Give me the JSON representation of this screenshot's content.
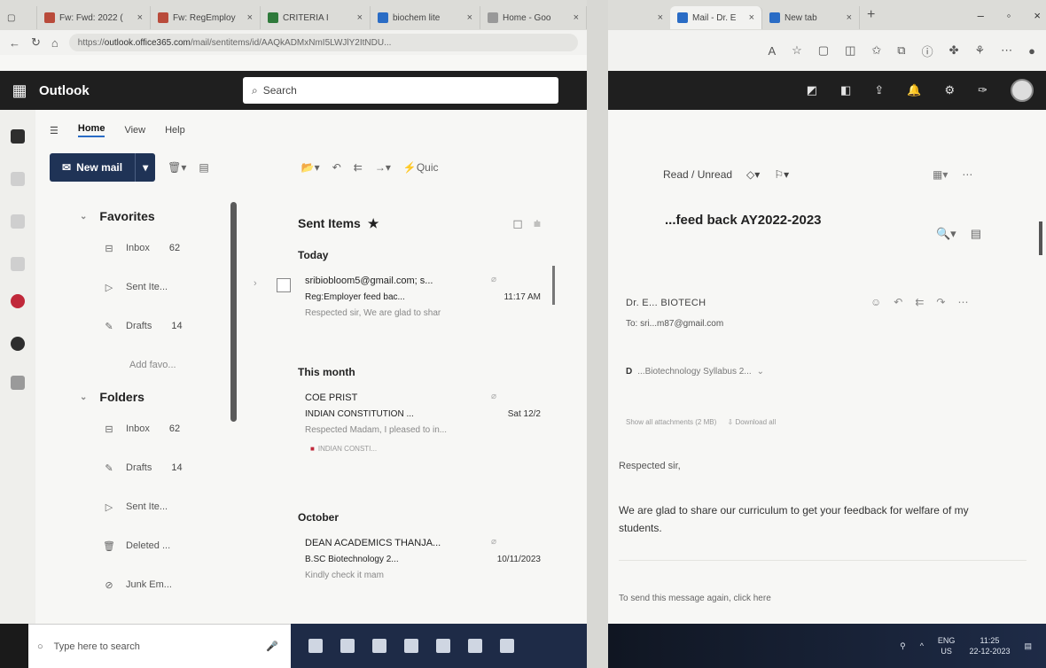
{
  "browser": {
    "tabs_left": [
      {
        "label": "Fw: Fwd: 2022 (",
        "icon_color": "#b94b3b"
      },
      {
        "label": "Fw: RegEmploy",
        "icon_color": "#b94b3b"
      },
      {
        "label": "CRITERIA I",
        "icon_color": "#2f7a3b"
      },
      {
        "label": "biochem lite",
        "icon_color": "#2a6cc5"
      },
      {
        "label": "Home - Goo",
        "icon_color": "#999999"
      }
    ],
    "tabs_right": [
      {
        "label": "Mail - Dr. E",
        "icon_color": "#2a6cc5"
      },
      {
        "label": "New tab",
        "icon_color": "#2a6cc5"
      }
    ],
    "url_prefix": "https://",
    "url_host": "outlook.office365.com",
    "url_path": "/mail/sentitems/id/AAQkADMxNmI5LWJlY2ItNDU..."
  },
  "outlook": {
    "brand": "Outlook",
    "search_placeholder": "Search",
    "ribbon_tabs": [
      "Home",
      "View",
      "Help"
    ],
    "new_mail": "New mail",
    "quick_steps": "Quic",
    "folders": {
      "favorites_label": "Favorites",
      "favorites": [
        {
          "label": "Inbox",
          "count": "62",
          "icon": "inbox-icon"
        },
        {
          "label": "Sent Ite...",
          "count": "",
          "icon": "send-icon"
        },
        {
          "label": "Drafts",
          "count": "14",
          "icon": "drafts-icon"
        }
      ],
      "add_favorite": "Add favo...",
      "folders_label": "Folders",
      "folders": [
        {
          "label": "Inbox",
          "count": "62",
          "icon": "inbox-icon"
        },
        {
          "label": "Drafts",
          "count": "14",
          "icon": "drafts-icon"
        },
        {
          "label": "Sent Ite...",
          "count": "",
          "icon": "send-icon"
        },
        {
          "label": "Deleted ...",
          "count": "",
          "icon": "trash-icon"
        },
        {
          "label": "Junk Em...",
          "count": "",
          "icon": "junk-icon"
        }
      ]
    },
    "list": {
      "title": "Sent Items",
      "sections": [
        {
          "heading": "Today",
          "messages": [
            {
              "from": "sribiobloom5@gmail.com; s...",
              "subject": "Reg:Employer feed bac...",
              "time": "11:17 AM",
              "preview": "Respected sir, We are glad to shar",
              "attachment": ""
            }
          ]
        },
        {
          "heading": "This month",
          "messages": [
            {
              "from": "COE PRIST",
              "subject": "INDIAN CONSTITUTION ...",
              "time": "Sat 12/2",
              "preview": "Respected Madam, I pleased to in...",
              "attachment": "INDIAN CONSTI..."
            }
          ]
        },
        {
          "heading": "October",
          "messages": [
            {
              "from": "DEAN ACADEMICS THANJA...",
              "subject": "B.SC Biotechnology 2...",
              "time": "10/11/2023",
              "preview": "Kindly check it mam",
              "attachment": ""
            }
          ]
        }
      ]
    }
  },
  "reading": {
    "toolbar_read": "Read / Unread",
    "subject": "...feed back AY2022-2023",
    "sender": "Dr. E... BIOTECH",
    "to": "To: sri...m87@gmail.com",
    "attachment_name": "...Biotechnology Syllabus 2...",
    "attach_info": "Show all attachments (2 MB)",
    "download_all": "Download all",
    "greeting": "Respected sir,",
    "body": "We are glad to share our curriculum to get your feedback for welfare of my students.",
    "send_again": "To send this message again,  click here"
  },
  "taskbar": {
    "search": "Type here to search",
    "lang": "ENG",
    "region": "US",
    "time": "11:25",
    "date": "22-12-2023"
  }
}
